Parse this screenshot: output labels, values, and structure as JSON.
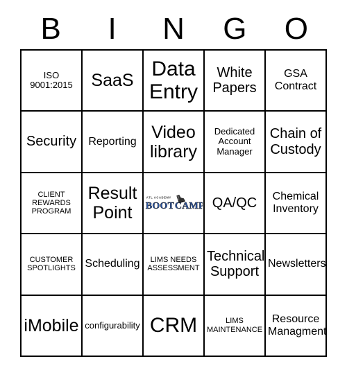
{
  "card": {
    "header_letters": [
      "B",
      "I",
      "N",
      "G",
      "O"
    ],
    "columns": 5,
    "rows": 5,
    "border_color": "#000000",
    "background_color": "#ffffff",
    "text_color": "#000000"
  },
  "cells": [
    {
      "row": 1,
      "col": 1,
      "column_letter": "B",
      "text": "ISO 9001:2015",
      "size": "fs-sm",
      "marked": false
    },
    {
      "row": 1,
      "col": 2,
      "column_letter": "I",
      "text": "SaaS",
      "size": "fs-xl",
      "marked": false
    },
    {
      "row": 1,
      "col": 3,
      "column_letter": "N",
      "text": "Data Entry",
      "size": "fs-xxl",
      "marked": false
    },
    {
      "row": 1,
      "col": 4,
      "column_letter": "G",
      "text": "White Papers",
      "size": "fs-lg",
      "marked": false
    },
    {
      "row": 1,
      "col": 5,
      "column_letter": "O",
      "text": "GSA Contract",
      "size": "fs-md",
      "marked": false
    },
    {
      "row": 2,
      "col": 1,
      "column_letter": "B",
      "text": "Security",
      "size": "fs-lg",
      "marked": false
    },
    {
      "row": 2,
      "col": 2,
      "column_letter": "I",
      "text": "Reporting",
      "size": "fs-md",
      "marked": false
    },
    {
      "row": 2,
      "col": 3,
      "column_letter": "N",
      "text": "Video library",
      "size": "fs-xl",
      "marked": false
    },
    {
      "row": 2,
      "col": 4,
      "column_letter": "G",
      "text": "Dedicated Account Manager",
      "size": "fs-sm",
      "marked": false
    },
    {
      "row": 2,
      "col": 5,
      "column_letter": "O",
      "text": "Chain of Custody",
      "size": "fs-lg",
      "marked": false
    },
    {
      "row": 3,
      "col": 1,
      "column_letter": "B",
      "text": "CLIENT REWARDS PROGRAM",
      "size": "fs-xs",
      "marked": false
    },
    {
      "row": 3,
      "col": 2,
      "column_letter": "I",
      "text": "Result Point",
      "size": "fs-xl",
      "marked": false
    },
    {
      "row": 3,
      "col": 3,
      "column_letter": "N",
      "text": "",
      "size": "fs-md",
      "marked": false,
      "is_free_space": true
    },
    {
      "row": 3,
      "col": 4,
      "column_letter": "G",
      "text": "QA/QC",
      "size": "fs-lg",
      "marked": false
    },
    {
      "row": 3,
      "col": 5,
      "column_letter": "O",
      "text": "Chemical Inventory",
      "size": "fs-md",
      "marked": false
    },
    {
      "row": 4,
      "col": 1,
      "column_letter": "B",
      "text": "CUSTOMER SPOTLIGHTS",
      "size": "fs-xs",
      "marked": false
    },
    {
      "row": 4,
      "col": 2,
      "column_letter": "I",
      "text": "Scheduling",
      "size": "fs-md",
      "marked": false
    },
    {
      "row": 4,
      "col": 3,
      "column_letter": "N",
      "text": "LIMS NEEDS ASSESSMENT",
      "size": "fs-xs",
      "marked": false
    },
    {
      "row": 4,
      "col": 4,
      "column_letter": "G",
      "text": "Technical Support",
      "size": "fs-lg",
      "marked": false
    },
    {
      "row": 4,
      "col": 5,
      "column_letter": "O",
      "text": "Newsletters",
      "size": "fs-md",
      "marked": false
    },
    {
      "row": 5,
      "col": 1,
      "column_letter": "B",
      "text": "iMobile",
      "size": "fs-xl",
      "marked": false
    },
    {
      "row": 5,
      "col": 2,
      "column_letter": "I",
      "text": "configurability",
      "size": "fs-sm",
      "marked": false
    },
    {
      "row": 5,
      "col": 3,
      "column_letter": "N",
      "text": "CRM",
      "size": "fs-xxl",
      "marked": false
    },
    {
      "row": 5,
      "col": 4,
      "column_letter": "G",
      "text": "LIMS MAINTENANCE",
      "size": "fs-xs",
      "marked": false
    },
    {
      "row": 5,
      "col": 5,
      "column_letter": "O",
      "text": "Resource Managment",
      "size": "fs-md",
      "marked": false
    }
  ],
  "free_space_logo": {
    "tagline": "ATL ACADEMY",
    "word_one": "BOOT",
    "word_two": "CAMP",
    "icon": "boot-icon",
    "text_color": "#2b55a4",
    "outline_color": "#1a1a1a"
  }
}
